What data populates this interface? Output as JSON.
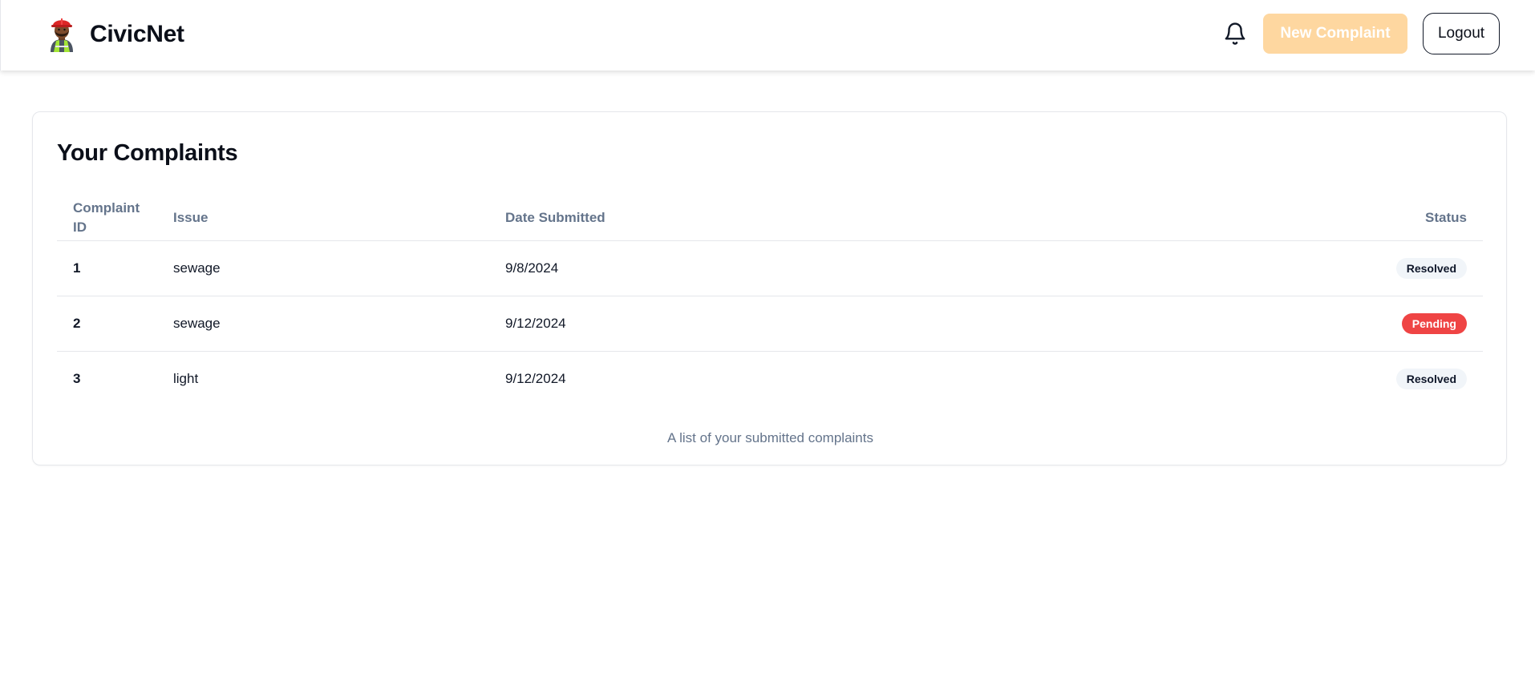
{
  "header": {
    "logo_icon": "construction-worker-emoji",
    "brand": "CivicNet",
    "notification_icon": "bell-icon",
    "new_complaint_label": "New Complaint",
    "logout_label": "Logout"
  },
  "complaints": {
    "title": "Your Complaints",
    "columns": {
      "id": "Complaint ID",
      "issue": "Issue",
      "date": "Date Submitted",
      "status": "Status"
    },
    "rows": [
      {
        "id": "1",
        "issue": "sewage",
        "date": "9/8/2024",
        "status": "Resolved"
      },
      {
        "id": "2",
        "issue": "sewage",
        "date": "9/12/2024",
        "status": "Pending"
      },
      {
        "id": "3",
        "issue": "light",
        "date": "9/12/2024",
        "status": "Resolved"
      }
    ],
    "caption": "A list of your submitted complaints"
  },
  "colors": {
    "accent": "#fed7a0",
    "pending": "#ef4444",
    "resolved_bg": "#f1f5f9",
    "muted_text": "#64748b"
  }
}
